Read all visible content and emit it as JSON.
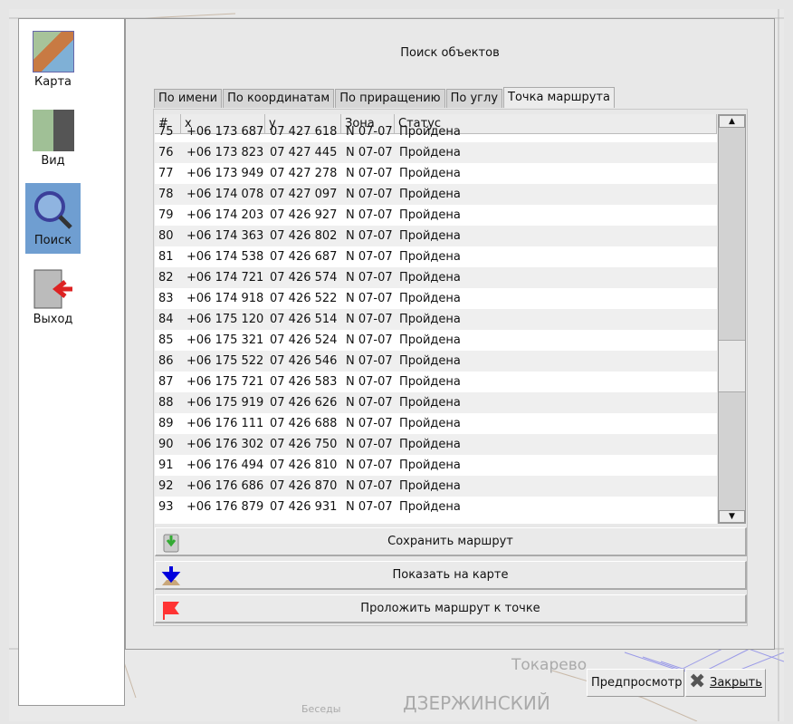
{
  "map": {
    "labels": [
      "Токарево",
      "ДЗЕРЖИНСКИЙ",
      "Беседы"
    ]
  },
  "sidebar": {
    "items": [
      {
        "label": "Карта",
        "icon": "map-icon"
      },
      {
        "label": "Вид",
        "icon": "view-icon"
      },
      {
        "label": "Поиск",
        "icon": "search-icon",
        "active": true
      },
      {
        "label": "Выход",
        "icon": "exit-icon"
      }
    ]
  },
  "dialog": {
    "title": "Поиск объектов",
    "tabs": [
      "По имени",
      "По координатам",
      "По приращению",
      "По углу",
      "Точка маршрута"
    ],
    "active_tab": 4,
    "table": {
      "columns": [
        "#",
        "x",
        "y",
        "Зона",
        "Статус"
      ],
      "rows": [
        [
          "75",
          "+06 173 687",
          "07 427 618",
          "N 07-07",
          "Пройдена"
        ],
        [
          "76",
          "+06 173 823",
          "07 427 445",
          "N 07-07",
          "Пройдена"
        ],
        [
          "77",
          "+06 173 949",
          "07 427 278",
          "N 07-07",
          "Пройдена"
        ],
        [
          "78",
          "+06 174 078",
          "07 427 097",
          "N 07-07",
          "Пройдена"
        ],
        [
          "79",
          "+06 174 203",
          "07 426 927",
          "N 07-07",
          "Пройдена"
        ],
        [
          "80",
          "+06 174 363",
          "07 426 802",
          "N 07-07",
          "Пройдена"
        ],
        [
          "81",
          "+06 174 538",
          "07 426 687",
          "N 07-07",
          "Пройдена"
        ],
        [
          "82",
          "+06 174 721",
          "07 426 574",
          "N 07-07",
          "Пройдена"
        ],
        [
          "83",
          "+06 174 918",
          "07 426 522",
          "N 07-07",
          "Пройдена"
        ],
        [
          "84",
          "+06 175 120",
          "07 426 514",
          "N 07-07",
          "Пройдена"
        ],
        [
          "85",
          "+06 175 321",
          "07 426 524",
          "N 07-07",
          "Пройдена"
        ],
        [
          "86",
          "+06 175 522",
          "07 426 546",
          "N 07-07",
          "Пройдена"
        ],
        [
          "87",
          "+06 175 721",
          "07 426 583",
          "N 07-07",
          "Пройдена"
        ],
        [
          "88",
          "+06 175 919",
          "07 426 626",
          "N 07-07",
          "Пройдена"
        ],
        [
          "89",
          "+06 176 111",
          "07 426 688",
          "N 07-07",
          "Пройдена"
        ],
        [
          "90",
          "+06 176 302",
          "07 426 750",
          "N 07-07",
          "Пройдена"
        ],
        [
          "91",
          "+06 176 494",
          "07 426 810",
          "N 07-07",
          "Пройдена"
        ],
        [
          "92",
          "+06 176 686",
          "07 426 870",
          "N 07-07",
          "Пройдена"
        ],
        [
          "93",
          "+06 176 879",
          "07 426 931",
          "N 07-07",
          "Пройдена"
        ]
      ]
    },
    "actions": [
      "Сохранить маршрут",
      "Показать на карте",
      "Проложить маршрут к точке"
    ]
  },
  "footer": {
    "preview": "Предпросмотр",
    "close": "Закрыть"
  }
}
